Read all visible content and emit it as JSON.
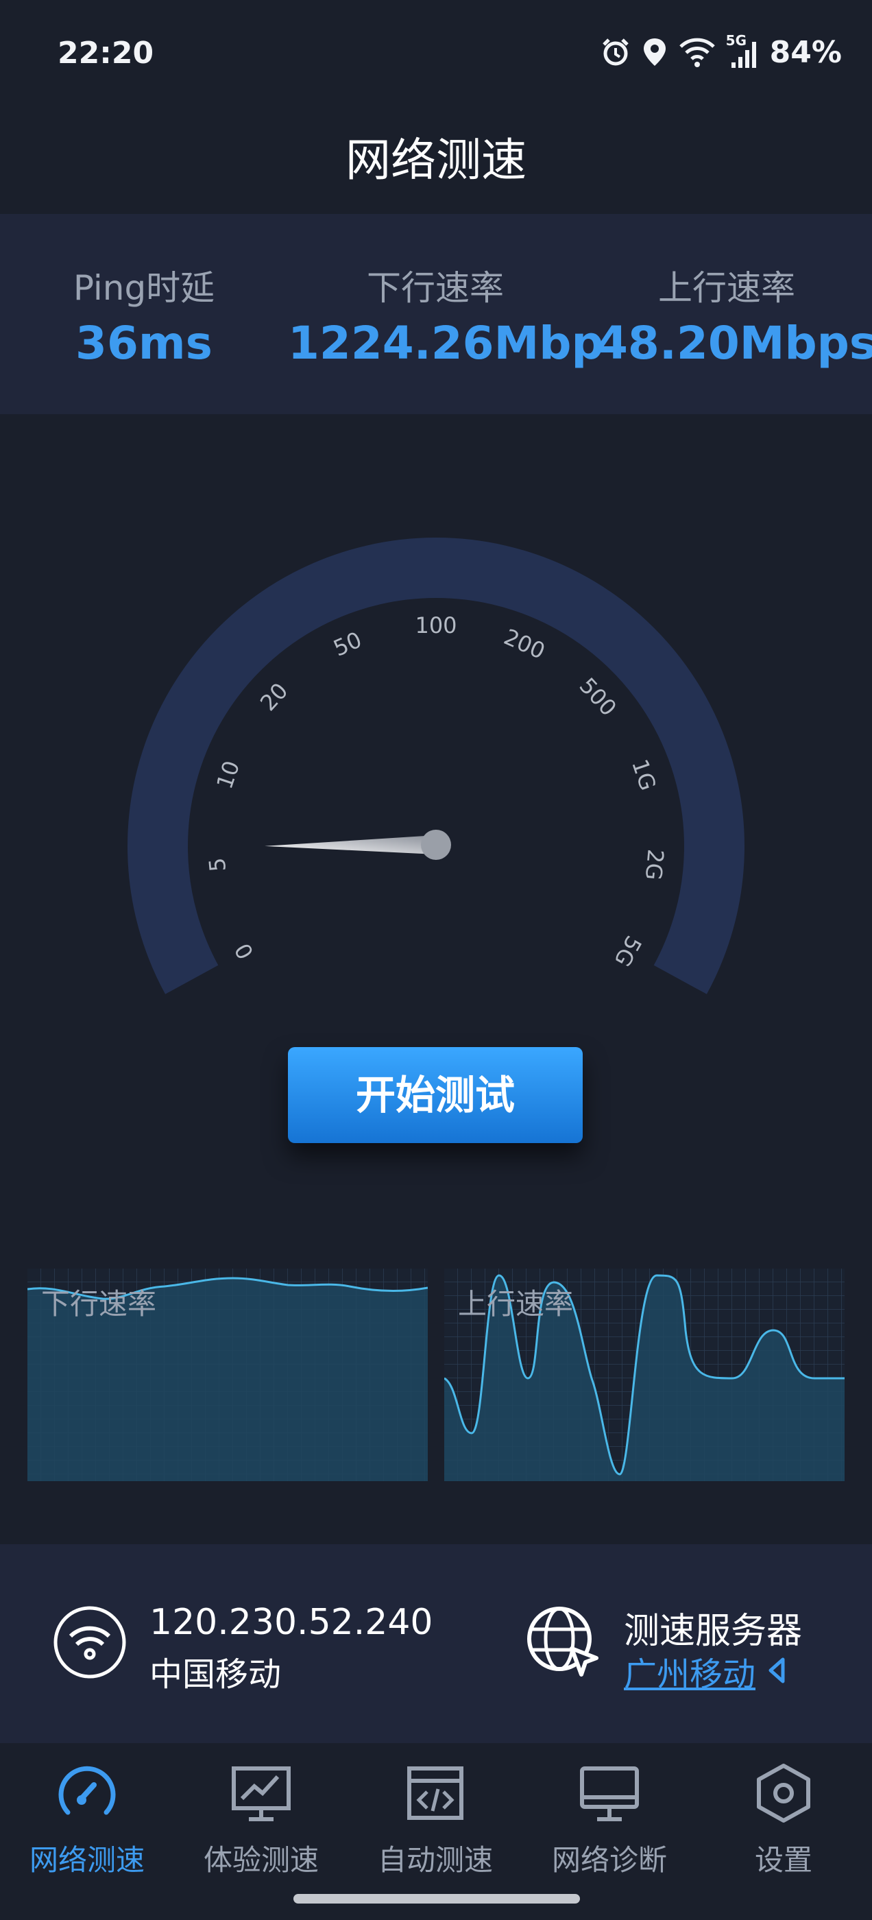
{
  "status_bar": {
    "time": "22:20",
    "network_label": "5G",
    "battery": "84%",
    "icons": [
      "alarm-icon",
      "location-icon",
      "wifi-icon",
      "signal-icon"
    ]
  },
  "header": {
    "title": "网络测速"
  },
  "stats": [
    {
      "label": "Ping时延",
      "value": "36ms"
    },
    {
      "label": "下行速率",
      "value": "1224.26Mbp"
    },
    {
      "label": "上行速率",
      "value": "48.20Mbps"
    }
  ],
  "gauge": {
    "tick_labels": [
      "0",
      "5",
      "10",
      "20",
      "50",
      "100",
      "200",
      "500",
      "1G",
      "2G",
      "5G"
    ],
    "needle_fraction": 0.12
  },
  "start_button": {
    "label": "开始测试"
  },
  "charts": {
    "download": {
      "label": "下行速率"
    },
    "upload": {
      "label": "上行速率"
    }
  },
  "network_info": {
    "ip": "120.230.52.240",
    "isp": "中国移动",
    "server_title": "测速服务器",
    "server_name": "广州移动"
  },
  "bottom_nav": [
    {
      "label": "网络测速",
      "icon": "speedometer-icon",
      "active": true
    },
    {
      "label": "体验测速",
      "icon": "chart-monitor-icon",
      "active": false
    },
    {
      "label": "自动测速",
      "icon": "code-window-icon",
      "active": false
    },
    {
      "label": "网络诊断",
      "icon": "desktop-icon",
      "active": false
    },
    {
      "label": "设置",
      "icon": "hexagon-settings-icon",
      "active": false
    }
  ],
  "colors": {
    "background": "#1a1f2b",
    "panel": "#20263a",
    "accent": "#3d9bf0",
    "gauge_track": "#243152",
    "chart_fill": "#1f4660",
    "chart_line": "#4ab8e8"
  }
}
